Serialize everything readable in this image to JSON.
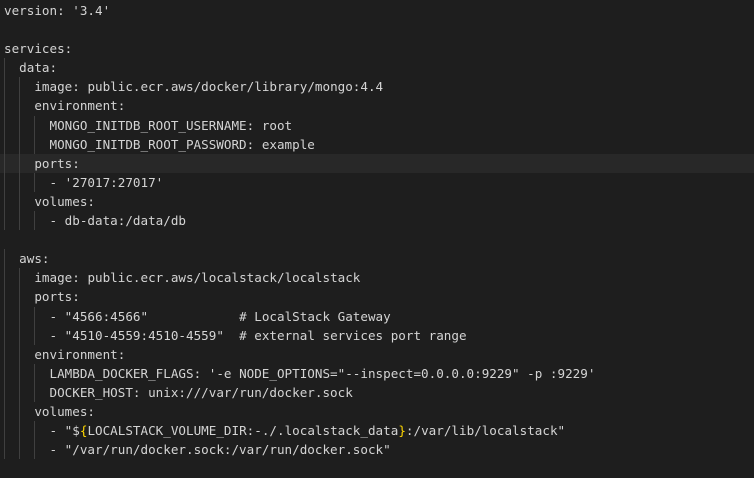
{
  "lines": [
    {
      "indent": 0,
      "segments": [
        {
          "t": "k",
          "text": "version"
        },
        {
          "t": "p",
          "text": ": "
        },
        {
          "t": "s",
          "text": "'3.4'"
        }
      ]
    },
    {
      "indent": 0,
      "segments": []
    },
    {
      "indent": 0,
      "segments": [
        {
          "t": "k",
          "text": "services"
        },
        {
          "t": "p",
          "text": ":"
        }
      ]
    },
    {
      "indent": 1,
      "segments": [
        {
          "t": "k",
          "text": "data"
        },
        {
          "t": "p",
          "text": ":"
        }
      ]
    },
    {
      "indent": 2,
      "segments": [
        {
          "t": "k",
          "text": "image"
        },
        {
          "t": "p",
          "text": ": "
        },
        {
          "t": "s",
          "text": "public.ecr.aws/docker/library/mongo:4.4"
        }
      ]
    },
    {
      "indent": 2,
      "segments": [
        {
          "t": "k",
          "text": "environment"
        },
        {
          "t": "p",
          "text": ":"
        }
      ]
    },
    {
      "indent": 3,
      "segments": [
        {
          "t": "k",
          "text": "MONGO_INITDB_ROOT_USERNAME"
        },
        {
          "t": "p",
          "text": ": "
        },
        {
          "t": "s",
          "text": "root"
        }
      ]
    },
    {
      "indent": 3,
      "segments": [
        {
          "t": "k",
          "text": "MONGO_INITDB_ROOT_PASSWORD"
        },
        {
          "t": "p",
          "text": ": "
        },
        {
          "t": "s",
          "text": "example"
        }
      ]
    },
    {
      "indent": 2,
      "highlight": true,
      "segments": [
        {
          "t": "k",
          "text": "ports"
        },
        {
          "t": "p",
          "text": ":"
        }
      ]
    },
    {
      "indent": 3,
      "segments": [
        {
          "t": "p",
          "text": "- "
        },
        {
          "t": "s",
          "text": "'27017:27017'"
        }
      ]
    },
    {
      "indent": 2,
      "segments": [
        {
          "t": "k",
          "text": "volumes"
        },
        {
          "t": "p",
          "text": ":"
        }
      ]
    },
    {
      "indent": 3,
      "segments": [
        {
          "t": "p",
          "text": "- "
        },
        {
          "t": "s",
          "text": "db-data:/data/db"
        }
      ]
    },
    {
      "indent": 0,
      "segments": []
    },
    {
      "indent": 1,
      "segments": [
        {
          "t": "k",
          "text": "aws"
        },
        {
          "t": "p",
          "text": ":"
        }
      ]
    },
    {
      "indent": 2,
      "segments": [
        {
          "t": "k",
          "text": "image"
        },
        {
          "t": "p",
          "text": ": "
        },
        {
          "t": "s",
          "text": "public.ecr.aws/localstack/localstack"
        }
      ]
    },
    {
      "indent": 2,
      "segments": [
        {
          "t": "k",
          "text": "ports"
        },
        {
          "t": "p",
          "text": ":"
        }
      ]
    },
    {
      "indent": 3,
      "segments": [
        {
          "t": "p",
          "text": "- "
        },
        {
          "t": "s",
          "text": "\"4566:4566\""
        },
        {
          "t": "p",
          "text": "            "
        },
        {
          "t": "c",
          "text": "# LocalStack Gateway"
        }
      ]
    },
    {
      "indent": 3,
      "segments": [
        {
          "t": "p",
          "text": "- "
        },
        {
          "t": "s",
          "text": "\"4510-4559:4510-4559\""
        },
        {
          "t": "p",
          "text": "  "
        },
        {
          "t": "c",
          "text": "# external services port range"
        }
      ]
    },
    {
      "indent": 2,
      "segments": [
        {
          "t": "k",
          "text": "environment"
        },
        {
          "t": "p",
          "text": ":"
        }
      ]
    },
    {
      "indent": 3,
      "segments": [
        {
          "t": "k",
          "text": "LAMBDA_DOCKER_FLAGS"
        },
        {
          "t": "p",
          "text": ": "
        },
        {
          "t": "s",
          "text": "'-e NODE_OPTIONS=\"--inspect=0.0.0.0:9229\" -p :9229'"
        }
      ]
    },
    {
      "indent": 3,
      "segments": [
        {
          "t": "k",
          "text": "DOCKER_HOST"
        },
        {
          "t": "p",
          "text": ": "
        },
        {
          "t": "s",
          "text": "unix:///var/run/docker.sock"
        }
      ]
    },
    {
      "indent": 2,
      "segments": [
        {
          "t": "k",
          "text": "volumes"
        },
        {
          "t": "p",
          "text": ":"
        }
      ]
    },
    {
      "indent": 3,
      "segments": [
        {
          "t": "p",
          "text": "- "
        },
        {
          "t": "s",
          "text": "\"$"
        },
        {
          "t": "b",
          "text": "{"
        },
        {
          "t": "s",
          "text": "LOCALSTACK_VOLUME_DIR:-./.localstack_data"
        },
        {
          "t": "b",
          "text": "}"
        },
        {
          "t": "s",
          "text": ":/var/lib/localstack\""
        }
      ]
    },
    {
      "indent": 3,
      "segments": [
        {
          "t": "p",
          "text": "- "
        },
        {
          "t": "s",
          "text": "\"/var/run/docker.sock:/var/run/docker.sock\""
        }
      ]
    },
    {
      "indent": 0,
      "segments": []
    }
  ],
  "colors": {
    "background": "#1e1e1e",
    "text": "#d4d4d4",
    "bracket": "#ffd700",
    "indent_guide": "#404040",
    "line_highlight": "#282828"
  }
}
